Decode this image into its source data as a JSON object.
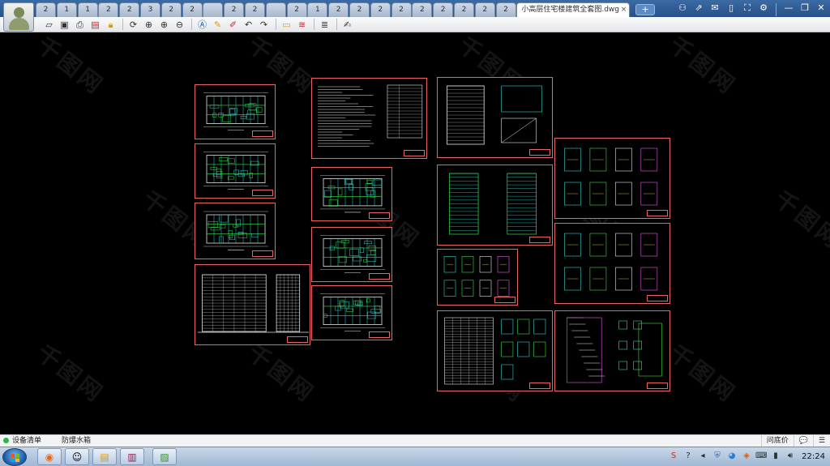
{
  "window": {
    "active_tab_title": "小高层住宅楼建筑全套图.dwg",
    "tab_close": "×",
    "new_tab": "+",
    "tabs": [
      "2",
      "1",
      "1",
      "2",
      "2",
      "3",
      "2",
      "2",
      "",
      "2",
      "2",
      "",
      "2",
      "1",
      "2",
      "2",
      "2",
      "2",
      "2",
      "2",
      "2",
      "2",
      "2"
    ]
  },
  "window_controls": {
    "contacts": "⚇",
    "share": "⇗",
    "chat": "✉",
    "phone": "▯",
    "fullscreen": "⛶",
    "settings": "⚙",
    "minimize": "—",
    "restore": "❐",
    "close": "✕"
  },
  "toolbar": {
    "icons": [
      "open-folder",
      "save",
      "print",
      "export-pdf",
      "lock",
      "rotate",
      "zoom-window",
      "zoom-in",
      "zoom-out",
      "text",
      "pencil",
      "pen",
      "undo",
      "redo",
      "measure",
      "layers",
      "layers-stack",
      "edit-doc"
    ]
  },
  "watermark": {
    "text": "千图网"
  },
  "status": {
    "device_list": "设备清单",
    "anti_fog": "防爆水箱",
    "ask_price": "问底价",
    "feedback": "💬",
    "menu": "☰"
  },
  "taskbar": {
    "time": "22:24",
    "apps": [
      "start",
      "browser",
      "qq",
      "explorer",
      "winrar",
      "photo-viewer"
    ]
  },
  "colors": {
    "sheet_border": "#e86565",
    "line_cyan": "#30d5d0",
    "line_green": "#39e04a",
    "line_white": "#e6e6e6",
    "line_yellow": "#f3e35a",
    "line_magenta": "#e35ce3"
  }
}
